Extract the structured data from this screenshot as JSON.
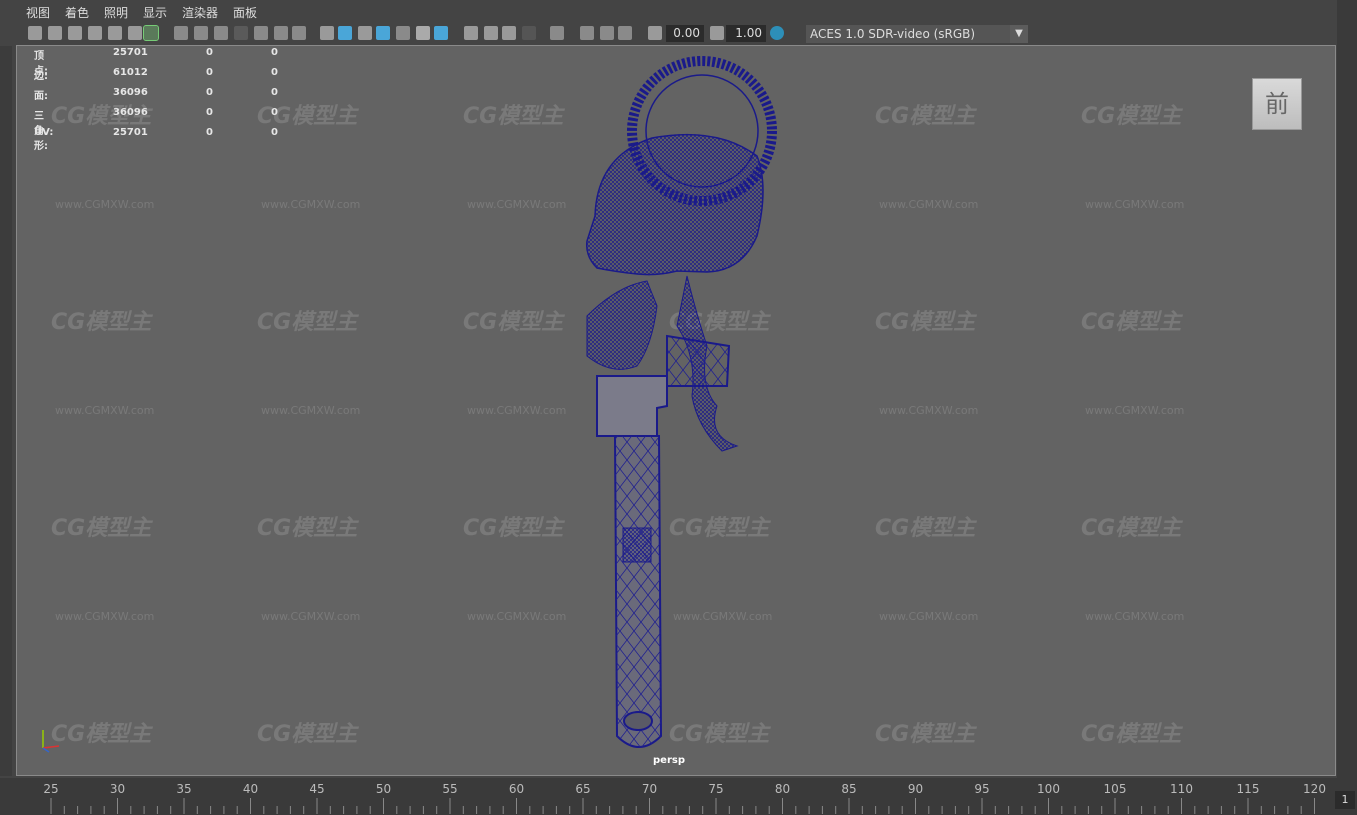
{
  "menu": [
    "视图",
    "着色",
    "照明",
    "显示",
    "渲染器",
    "面板"
  ],
  "toolbar": {
    "exposure": "0.00",
    "gamma": "1.00",
    "color_space": "ACES 1.0 SDR-video (sRGB)"
  },
  "stats": [
    {
      "label": "顶点:",
      "v1": "25701",
      "v2": "0",
      "v3": "0"
    },
    {
      "label": "边:",
      "v1": "61012",
      "v2": "0",
      "v3": "0"
    },
    {
      "label": "面:",
      "v1": "36096",
      "v2": "0",
      "v3": "0"
    },
    {
      "label": "三角形:",
      "v1": "36096",
      "v2": "0",
      "v3": "0"
    },
    {
      "label": "UV:",
      "v1": "25701",
      "v2": "0",
      "v3": "0"
    }
  ],
  "camera_label": "persp",
  "view_cube_label": "前",
  "watermark": {
    "logo": "CG模型主",
    "url": "www.CGMXW.com"
  },
  "timeline": {
    "ticks": [
      "25",
      "30",
      "35",
      "40",
      "45",
      "50",
      "55",
      "60",
      "65",
      "70",
      "75",
      "80",
      "85",
      "90",
      "95",
      "100",
      "105",
      "110",
      "115",
      "120"
    ],
    "current_frame": "1"
  }
}
